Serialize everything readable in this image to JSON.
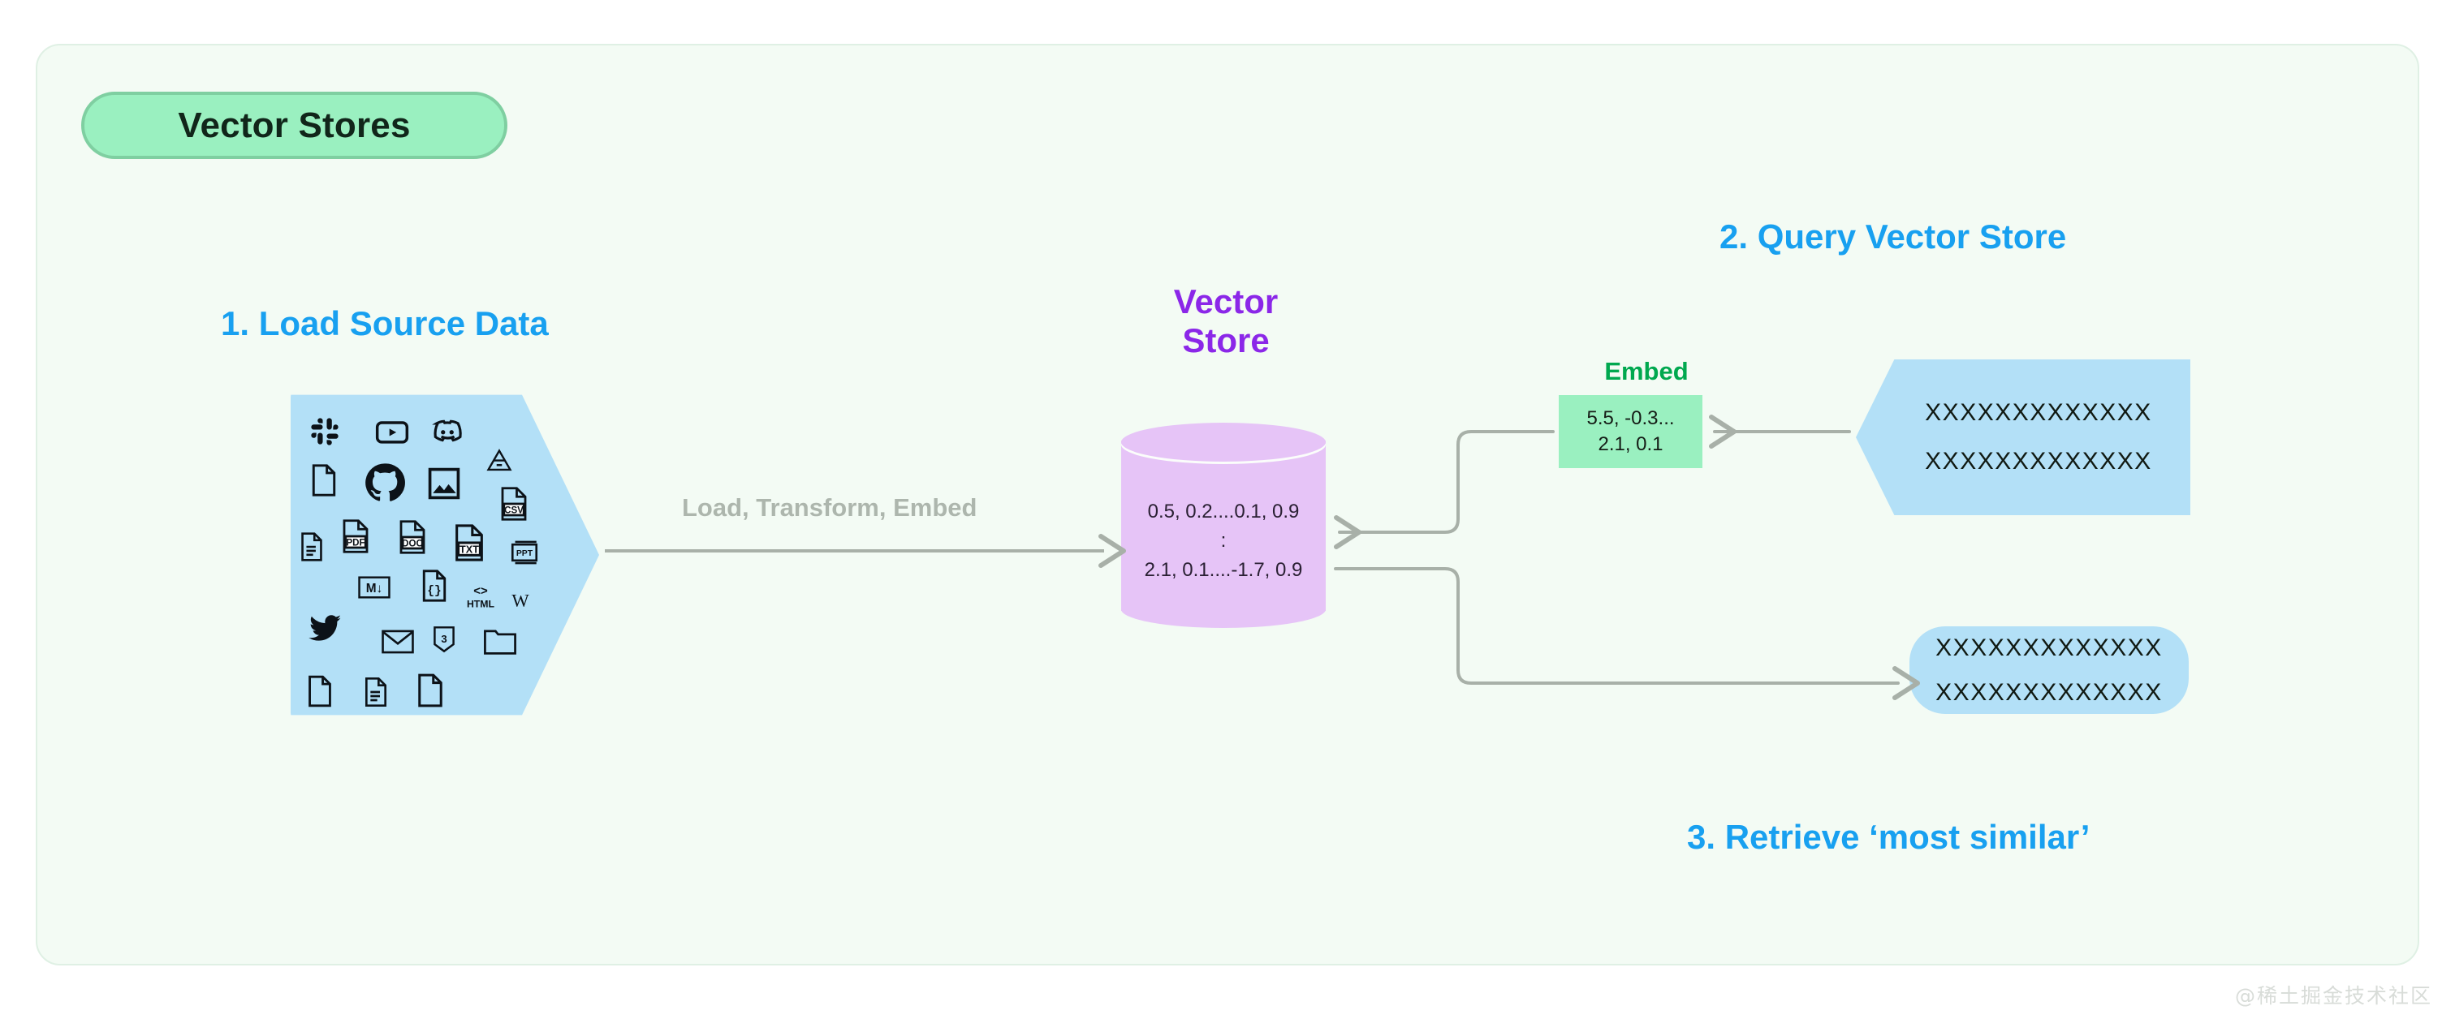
{
  "page": {
    "background": "#ffffff",
    "card_background": "#f3fbf4",
    "card_border": "#dff0e4",
    "watermark": "@稀土掘金技术社区"
  },
  "title_badge": {
    "label": "Vector Stores",
    "fill": "#9af0c0",
    "border": "#7fcfa1",
    "text_color": "#11261a"
  },
  "headings": {
    "accent": "#18a0f0",
    "step1": "1. Load Source Data",
    "step2": "2. Query Vector Store",
    "step3": "3. Retrieve ‘most similar’"
  },
  "source": {
    "shape": "pentagon-right",
    "fill": "#b3e0f7",
    "icons": [
      {
        "name": "slack-icon",
        "glyph": "⁂"
      },
      {
        "name": "youtube-icon",
        "glyph": "▶"
      },
      {
        "name": "discord-icon",
        "glyph": "◑"
      },
      {
        "name": "file-blank-icon",
        "glyph": "Ὄ4"
      },
      {
        "name": "github-icon",
        "glyph": "●"
      },
      {
        "name": "image-icon",
        "glyph": "Ὓc"
      },
      {
        "name": "google-drive-icon",
        "glyph": "△"
      },
      {
        "name": "csv-file-icon",
        "glyph": "CSV"
      },
      {
        "name": "document-lines-icon",
        "glyph": "≡"
      },
      {
        "name": "pdf-file-icon",
        "glyph": "PDF"
      },
      {
        "name": "doc-file-icon",
        "glyph": "DOC"
      },
      {
        "name": "txt-file-icon",
        "glyph": "TXT"
      },
      {
        "name": "ppt-file-icon",
        "glyph": "PPT"
      },
      {
        "name": "markdown-icon",
        "glyph": "M↓"
      },
      {
        "name": "json-file-icon",
        "glyph": "{ }"
      },
      {
        "name": "html-icon",
        "glyph": "HTML"
      },
      {
        "name": "wikipedia-icon",
        "glyph": "W"
      },
      {
        "name": "twitter-icon",
        "glyph": "ὂ6"
      },
      {
        "name": "email-icon",
        "glyph": "✉"
      },
      {
        "name": "css3-icon",
        "glyph": "3"
      },
      {
        "name": "folder-icon",
        "glyph": "Ὄ1"
      },
      {
        "name": "file-page-icon",
        "glyph": "Ὄ4"
      },
      {
        "name": "file-text-icon",
        "glyph": "Ὄ3"
      },
      {
        "name": "file-plain-icon",
        "glyph": "Ὄ4"
      }
    ]
  },
  "pipeline": {
    "label": "Load, Transform, Embed",
    "color": "#adb6ad"
  },
  "vector_store": {
    "title_line1": "Vector",
    "title_line2": "Store",
    "title_color": "#8b27e8",
    "fill": "#e6c4f7",
    "row1": "0.5, 0.2....0.1, 0.9",
    "ellipsis": ":",
    "row2": "2.1, 0.1....-1.7, 0.9"
  },
  "embed": {
    "label": "Embed",
    "label_color": "#00a84f",
    "fill": "#9af0c0",
    "line1": "5.5, -0.3...",
    "line2": "2.1, 0.1"
  },
  "query": {
    "fill": "#b3e0f7",
    "line1": "XXXXXXXXXXXXX",
    "line2": "XXXXXXXXXXXXX"
  },
  "result": {
    "fill": "#b3e0f7",
    "line1": "XXXXXXXXXXXXX",
    "line2": "XXXXXXXXXXXXX"
  },
  "connectors": {
    "stroke": "#a8b0a8"
  }
}
